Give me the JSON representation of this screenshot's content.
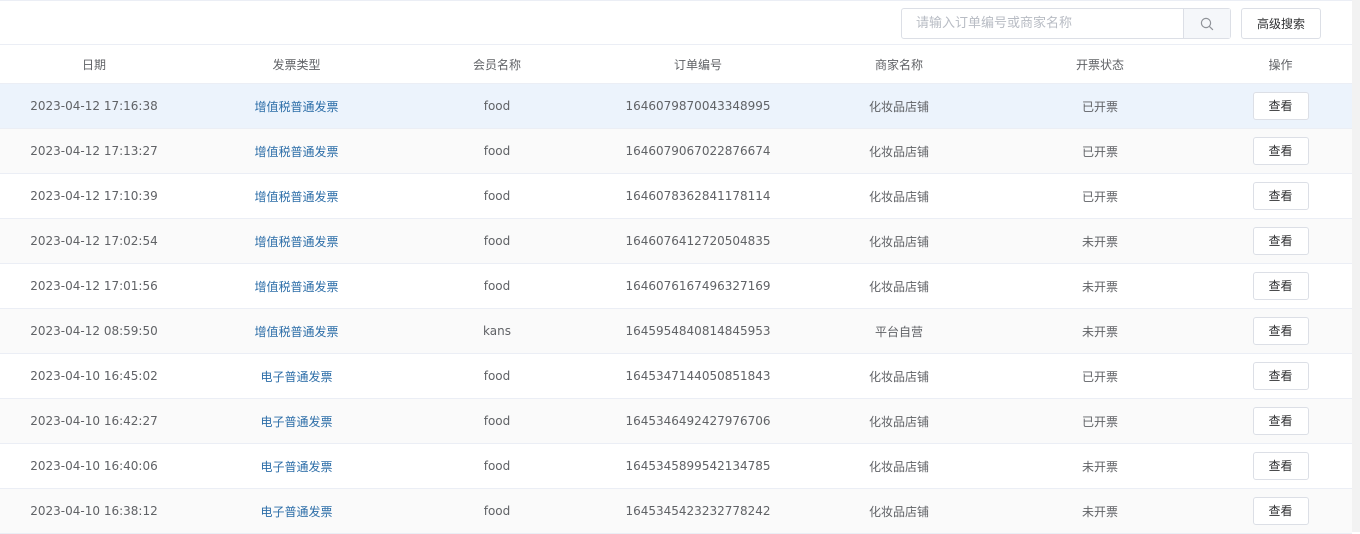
{
  "search": {
    "placeholder": "请输入订单编号或商家名称",
    "value": "",
    "advanced_label": "高级搜索",
    "icon": "search-icon"
  },
  "columns": [
    "日期",
    "发票类型",
    "会员名称",
    "订单编号",
    "商家名称",
    "开票状态",
    "操作"
  ],
  "rows": [
    {
      "date": "2023-04-12 17:16:38",
      "type": "增值税普通发票",
      "member": "food",
      "order": "1646079870043348995",
      "shop": "化妆品店铺",
      "status": "已开票",
      "action": "查看"
    },
    {
      "date": "2023-04-12 17:13:27",
      "type": "增值税普通发票",
      "member": "food",
      "order": "1646079067022876674",
      "shop": "化妆品店铺",
      "status": "已开票",
      "action": "查看"
    },
    {
      "date": "2023-04-12 17:10:39",
      "type": "增值税普通发票",
      "member": "food",
      "order": "1646078362841178114",
      "shop": "化妆品店铺",
      "status": "已开票",
      "action": "查看"
    },
    {
      "date": "2023-04-12 17:02:54",
      "type": "增值税普通发票",
      "member": "food",
      "order": "1646076412720504835",
      "shop": "化妆品店铺",
      "status": "未开票",
      "action": "查看"
    },
    {
      "date": "2023-04-12 17:01:56",
      "type": "增值税普通发票",
      "member": "food",
      "order": "1646076167496327169",
      "shop": "化妆品店铺",
      "status": "未开票",
      "action": "查看"
    },
    {
      "date": "2023-04-12 08:59:50",
      "type": "增值税普通发票",
      "member": "kans",
      "order": "1645954840814845953",
      "shop": "平台自营",
      "status": "未开票",
      "action": "查看"
    },
    {
      "date": "2023-04-10 16:45:02",
      "type": "电子普通发票",
      "member": "food",
      "order": "1645347144050851843",
      "shop": "化妆品店铺",
      "status": "已开票",
      "action": "查看"
    },
    {
      "date": "2023-04-10 16:42:27",
      "type": "电子普通发票",
      "member": "food",
      "order": "1645346492427976706",
      "shop": "化妆品店铺",
      "status": "已开票",
      "action": "查看"
    },
    {
      "date": "2023-04-10 16:40:06",
      "type": "电子普通发票",
      "member": "food",
      "order": "1645345899542134785",
      "shop": "化妆品店铺",
      "status": "未开票",
      "action": "查看"
    },
    {
      "date": "2023-04-10 16:38:12",
      "type": "电子普通发票",
      "member": "food",
      "order": "1645345423232778242",
      "shop": "化妆品店铺",
      "status": "未开票",
      "action": "查看"
    }
  ],
  "colors": {
    "link": "#2d6ea8",
    "highlight_row": "#ecf3fc",
    "striped_row": "#fafafa",
    "border": "#ebeef5"
  }
}
